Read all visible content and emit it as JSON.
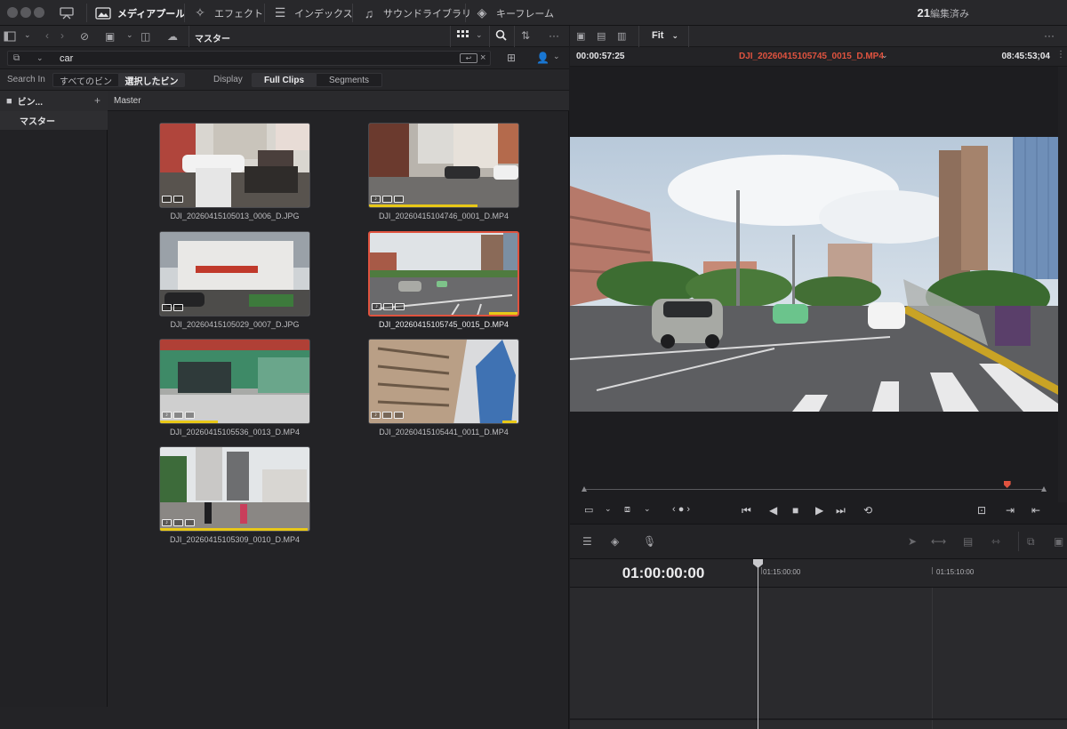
{
  "toolbar": {
    "media_pool": "メディアプール",
    "effects": "エフェクト",
    "index": "インデックス",
    "sound_library": "サウンドライブラリ",
    "keyframes": "キーフレーム",
    "count": "21",
    "status": "編集済み"
  },
  "pool": {
    "bin_title": "マスター",
    "search_value": "car",
    "search_in_label": "Search In",
    "scope_all": "すべてのビン",
    "scope_selected": "選択したビン",
    "display_label": "Display",
    "display_full": "Full Clips",
    "display_segments": "Segments",
    "bins_header": "ビン...",
    "bin_master": "マスター",
    "grid_header": "Master",
    "clips": [
      {
        "name": "DJI_20260415105013_0006_D.JPG"
      },
      {
        "name": "DJI_20260415104746_0001_D.MP4"
      },
      {
        "name": "DJI_20260415105029_0007_D.JPG"
      },
      {
        "name": "DJI_20260415105745_0015_D.MP4"
      },
      {
        "name": "DJI_20260415105536_0013_D.MP4"
      },
      {
        "name": "DJI_20260415105441_0011_D.MP4"
      },
      {
        "name": "DJI_20260415105309_0010_D.MP4"
      }
    ]
  },
  "viewer": {
    "zoom": "Fit",
    "timecode_left": "00:00:57:25",
    "clip_name": "DJI_20260415105745_0015_D.MP4",
    "timecode_right": "08:45:53;04",
    "playhead_fraction": 0.92
  },
  "timeline": {
    "timecode": "01:00:00:00",
    "ruler_1": "01:15:00:00",
    "ruler_2": "01:15:10:00"
  },
  "colors": {
    "accent_red": "#e0533f",
    "clip_bar": "#e8c817"
  }
}
